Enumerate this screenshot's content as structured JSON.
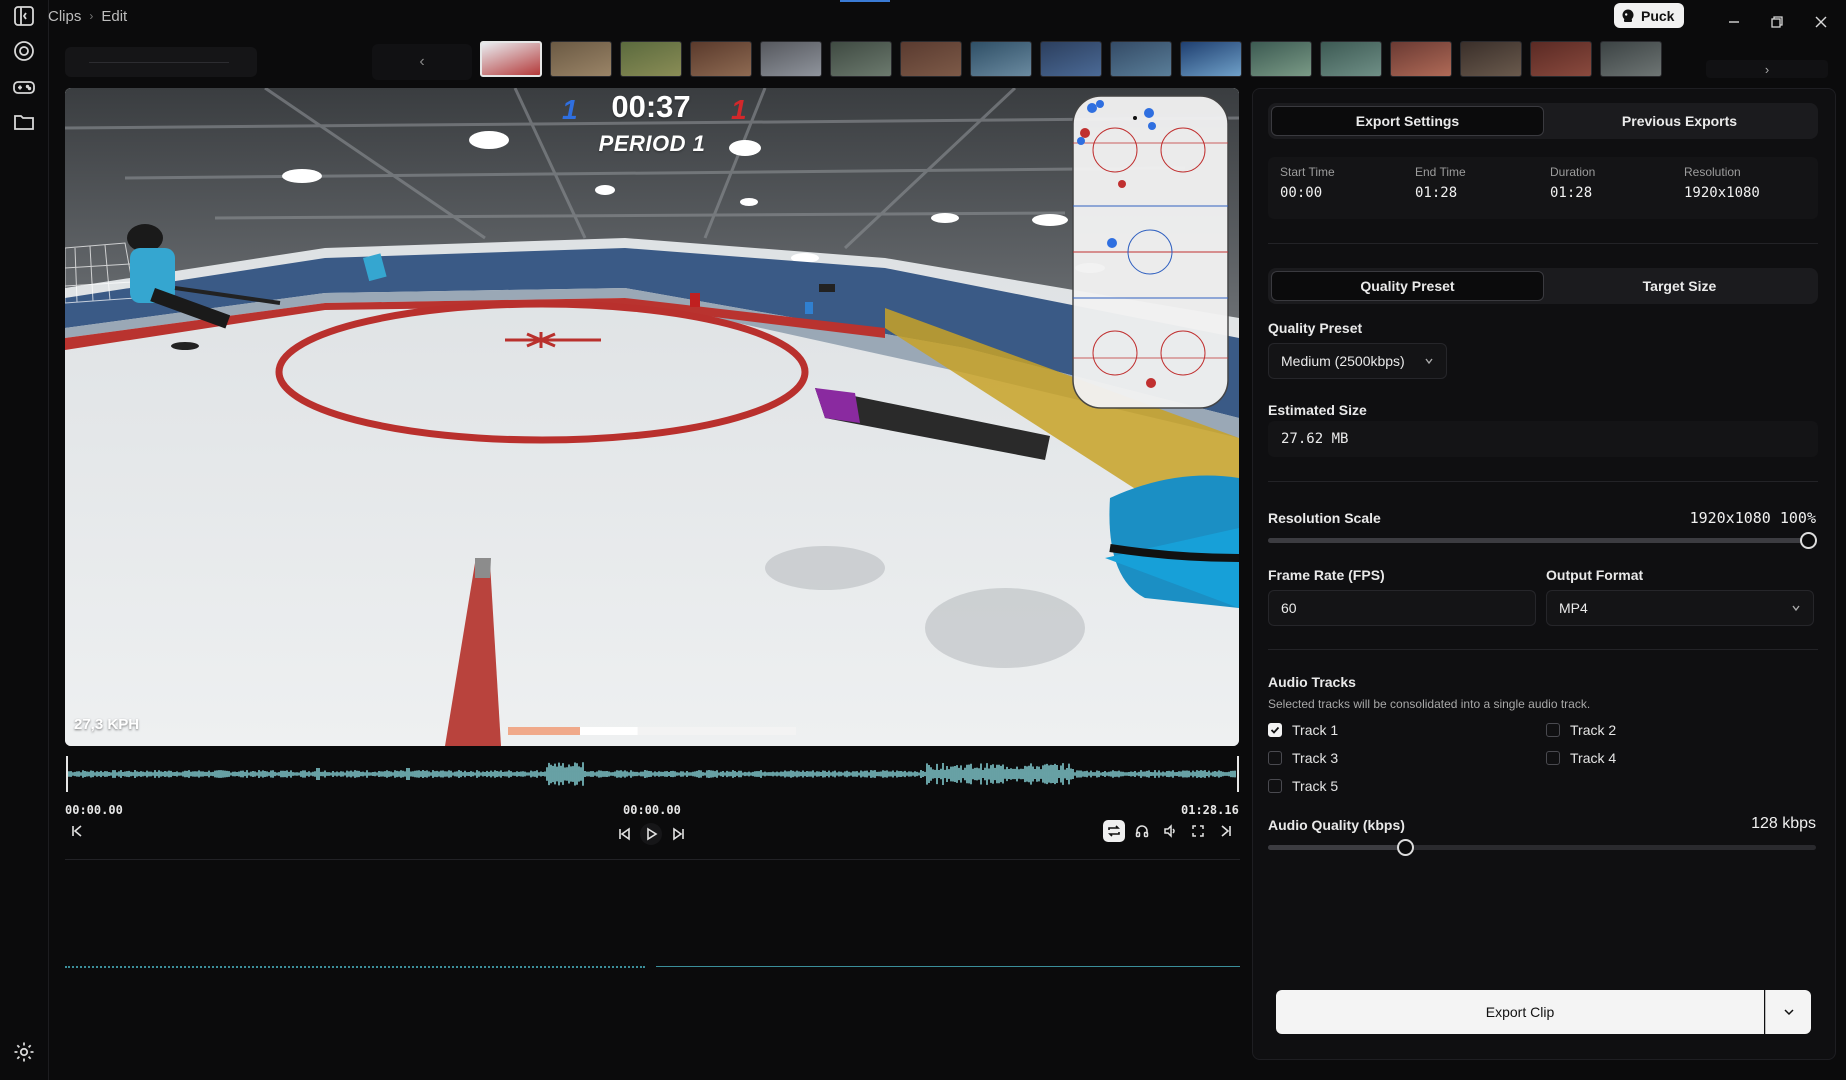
{
  "breadcrumb": {
    "root": "Clips",
    "current": "Edit"
  },
  "titlebar": {
    "user_badge": "Puck"
  },
  "thumbnails": [
    {
      "c1": "#e9edf1",
      "c2": "#b43a3a"
    },
    {
      "c1": "#6b5a44",
      "c2": "#9a8467"
    },
    {
      "c1": "#5b6a3e",
      "c2": "#8a8d56"
    },
    {
      "c1": "#5a3a2c",
      "c2": "#8e6a52"
    },
    {
      "c1": "#56585e",
      "c2": "#8f949c"
    },
    {
      "c1": "#3f4a42",
      "c2": "#6c7a6e"
    },
    {
      "c1": "#5a3b30",
      "c2": "#7d5a48"
    },
    {
      "c1": "#2f4f66",
      "c2": "#6a8aa0"
    },
    {
      "c1": "#2c3f5e",
      "c2": "#4b6a96"
    },
    {
      "c1": "#344b66",
      "c2": "#5a7e99"
    },
    {
      "c1": "#1f3f70",
      "c2": "#6fa0c8"
    },
    {
      "c1": "#3c5a52",
      "c2": "#7a9a86"
    },
    {
      "c1": "#3d5a54",
      "c2": "#6f8f86"
    },
    {
      "c1": "#6a3a33",
      "c2": "#b06a57"
    },
    {
      "c1": "#3a2f2a",
      "c2": "#6a5a4d"
    },
    {
      "c1": "#5a2a24",
      "c2": "#8a4a3e"
    },
    {
      "c1": "#3c4344",
      "c2": "#6e7574"
    }
  ],
  "video": {
    "clock": "00:37",
    "period": "PERIOD 1",
    "score_left": "1",
    "score_right": "1",
    "speed": "27,3 KPH",
    "progress_played": 0.25,
    "progress_buffered": 0.45
  },
  "timeline": {
    "start": "00:00.00",
    "current": "00:00.00",
    "end": "01:28.16"
  },
  "panel": {
    "tabs": [
      "Export Settings",
      "Previous Exports"
    ],
    "active_tab": 0,
    "info": [
      {
        "key": "Start Time",
        "value": "00:00"
      },
      {
        "key": "End Time",
        "value": "01:28"
      },
      {
        "key": "Duration",
        "value": "01:28"
      },
      {
        "key": "Resolution",
        "value": "1920x1080"
      }
    ],
    "mode_tabs": [
      "Quality Preset",
      "Target Size"
    ],
    "active_mode": 0,
    "quality_preset_label": "Quality Preset",
    "quality_preset_value": "Medium (2500kbps)",
    "estimated_size_label": "Estimated Size",
    "estimated_size_value": "27.62 MB",
    "resolution_scale_label": "Resolution Scale",
    "resolution_scale_value": "1920x1080 100%",
    "resolution_scale_fraction": 1.0,
    "frame_rate_label": "Frame Rate (FPS)",
    "frame_rate_value": "60",
    "output_format_label": "Output Format",
    "output_format_value": "MP4",
    "audio_tracks_label": "Audio Tracks",
    "audio_tracks_hint": "Selected tracks will be consolidated into a single audio track.",
    "tracks": [
      {
        "name": "Track 1",
        "checked": true
      },
      {
        "name": "Track 2",
        "checked": false
      },
      {
        "name": "Track 3",
        "checked": false
      },
      {
        "name": "Track 4",
        "checked": false
      },
      {
        "name": "Track 5",
        "checked": false
      }
    ],
    "audio_quality_label": "Audio Quality (kbps)",
    "audio_quality_value": "128  kbps",
    "audio_quality_fraction": 0.25,
    "export_button": "Export Clip"
  },
  "colors": {
    "accent_blue": "#3a7bd5",
    "waveform": "#7fc7cc",
    "team_blue": "#2f6fe0",
    "team_red": "#d2282b",
    "progress_played": "#f0a98a"
  }
}
